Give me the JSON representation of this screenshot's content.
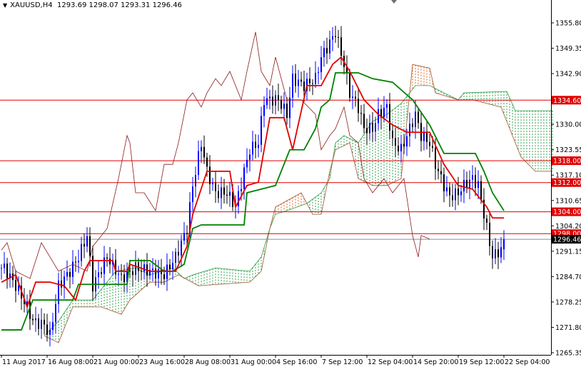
{
  "header": {
    "symbol": "XAUUSD,H4",
    "ohlc": "1293.69 1298.07 1293.31 1296.46"
  },
  "chart_data": {
    "type": "candlestick",
    "title": "XAUUSD,H4",
    "ylim": [
      1265.35,
      1355.8
    ],
    "y_ticks": [
      "1355.80",
      "1349.35",
      "1342.90",
      "1336.45",
      "1330.00",
      "1323.55",
      "1317.10",
      "1310.65",
      "1304.20",
      "1291.15",
      "1284.70",
      "1278.25",
      "1271.80",
      "1265.35"
    ],
    "x_ticks": [
      {
        "bar": 0,
        "label": "11 Aug 2017"
      },
      {
        "bar": 16,
        "label": "16 Aug 08:00"
      },
      {
        "bar": 32,
        "label": "21 Aug 00:00"
      },
      {
        "bar": 48,
        "label": "23 Aug 16:00"
      },
      {
        "bar": 64,
        "label": "28 Aug 08:00"
      },
      {
        "bar": 80,
        "label": "31 Aug 00:00"
      },
      {
        "bar": 96,
        "label": "4 Sep 16:00"
      },
      {
        "bar": 112,
        "label": "7 Sep 12:00"
      },
      {
        "bar": 128,
        "label": "12 Sep 04:00"
      },
      {
        "bar": 144,
        "label": "14 Sep 20:00"
      },
      {
        "bar": 160,
        "label": "19 Sep 12:00"
      },
      {
        "bar": 176,
        "label": "22 Sep 04:00"
      }
    ],
    "levels": [
      {
        "price": 1334.6,
        "label": "1334.60"
      },
      {
        "price": 1318.0,
        "label": "1318.00"
      },
      {
        "price": 1312.0,
        "label": "1312.00"
      },
      {
        "price": 1304.0,
        "label": "1304.00"
      },
      {
        "price": 1298.0,
        "label": "1298.00"
      }
    ],
    "current_price": {
      "price": 1296.46,
      "label": "1296.46"
    },
    "colors": {
      "level": "#e00000",
      "tenkan": "#e00000",
      "kijun": "#008000",
      "chikou": "#8b1a1a",
      "bull": "#0000ff",
      "bear": "#000000",
      "cloud_up": "#2e9e4a",
      "cloud_down": "#e06020"
    },
    "close_path": [
      [
        1,
        1288.6
      ],
      [
        5,
        1283.7
      ],
      [
        9,
        1277.9
      ],
      [
        11,
        1274.0
      ],
      [
        15,
        1273.0
      ],
      [
        17,
        1270.0
      ],
      [
        20,
        1283.7
      ],
      [
        24,
        1287.7
      ],
      [
        27,
        1291.6
      ],
      [
        30,
        1297.5
      ],
      [
        32,
        1283.7
      ],
      [
        37,
        1291.6
      ],
      [
        42,
        1285.7
      ],
      [
        47,
        1288.6
      ],
      [
        52,
        1287.7
      ],
      [
        57,
        1286.7
      ],
      [
        61,
        1291.6
      ],
      [
        65,
        1299.4
      ],
      [
        67,
        1311.2
      ],
      [
        70,
        1322.9
      ],
      [
        72,
        1315.1
      ],
      [
        75,
        1309.2
      ],
      [
        79,
        1309.2
      ],
      [
        82,
        1305.3
      ],
      [
        85,
        1315.1
      ],
      [
        87,
        1321.0
      ],
      [
        90,
        1322.9
      ],
      [
        92,
        1334.7
      ],
      [
        97,
        1334.7
      ],
      [
        100,
        1330.7
      ],
      [
        102,
        1340.5
      ],
      [
        106,
        1338.6
      ],
      [
        110,
        1340.5
      ],
      [
        112,
        1346.4
      ],
      [
        115,
        1350.3
      ],
      [
        117,
        1353.3
      ],
      [
        120,
        1344.4
      ],
      [
        122,
        1336.6
      ],
      [
        125,
        1332.7
      ],
      [
        127,
        1326.8
      ],
      [
        130,
        1326.8
      ],
      [
        132,
        1330.7
      ],
      [
        135,
        1332.7
      ],
      [
        137,
        1322.9
      ],
      [
        140,
        1321.0
      ],
      [
        142,
        1324.9
      ],
      [
        145,
        1330.7
      ],
      [
        147,
        1324.9
      ],
      [
        150,
        1322.9
      ],
      [
        152,
        1317.0
      ],
      [
        155,
        1311.2
      ],
      [
        157,
        1308.2
      ],
      [
        160,
        1309.2
      ],
      [
        162,
        1311.2
      ],
      [
        165,
        1313.1
      ],
      [
        167,
        1311.2
      ],
      [
        170,
        1299.4
      ],
      [
        172,
        1291.6
      ],
      [
        175,
        1293.69
      ],
      [
        176.5,
        1296.46
      ]
    ],
    "tenkan": [
      [
        0,
        1284.7
      ],
      [
        5,
        1286.7
      ],
      [
        9,
        1277.9
      ],
      [
        12,
        1284.7
      ],
      [
        17,
        1284.7
      ],
      [
        22,
        1283.7
      ],
      [
        26,
        1279.8
      ],
      [
        29,
        1287.7
      ],
      [
        31,
        1290.6
      ],
      [
        39,
        1290.6
      ],
      [
        40,
        1287.7
      ],
      [
        44,
        1287.7
      ],
      [
        45,
        1289.6
      ],
      [
        52,
        1287.7
      ],
      [
        57,
        1287.7
      ],
      [
        61,
        1287.7
      ],
      [
        65,
        1294.5
      ],
      [
        67,
        1303.3
      ],
      [
        72,
        1315.1
      ],
      [
        80,
        1315.1
      ],
      [
        82,
        1305.3
      ],
      [
        86,
        1311.2
      ],
      [
        90,
        1312.1
      ],
      [
        94,
        1329.8
      ],
      [
        99,
        1329.8
      ],
      [
        102,
        1321.0
      ],
      [
        107,
        1338.6
      ],
      [
        112,
        1338.6
      ],
      [
        116,
        1344.4
      ],
      [
        119,
        1346.4
      ],
      [
        122,
        1342.5
      ],
      [
        127,
        1334.7
      ],
      [
        132,
        1330.7
      ],
      [
        137,
        1327.8
      ],
      [
        142,
        1325.8
      ],
      [
        150,
        1325.8
      ],
      [
        155,
        1317.0
      ],
      [
        160,
        1311.2
      ],
      [
        165,
        1310.2
      ],
      [
        170,
        1305.3
      ],
      [
        172,
        1302.3
      ],
      [
        176,
        1302.3
      ]
    ],
    "kijun": [
      [
        0,
        1271.6
      ],
      [
        7,
        1271.6
      ],
      [
        11,
        1279.8
      ],
      [
        25,
        1279.8
      ],
      [
        27,
        1284.1
      ],
      [
        44,
        1284.1
      ],
      [
        45,
        1290.6
      ],
      [
        52,
        1290.6
      ],
      [
        57,
        1287.7
      ],
      [
        60,
        1287.7
      ],
      [
        64,
        1289.6
      ],
      [
        67,
        1299.4
      ],
      [
        70,
        1300.4
      ],
      [
        85,
        1300.4
      ],
      [
        86,
        1309.2
      ],
      [
        96,
        1311.2
      ],
      [
        101,
        1321.0
      ],
      [
        106,
        1321.0
      ],
      [
        110,
        1326.8
      ],
      [
        112,
        1332.7
      ],
      [
        115,
        1334.7
      ],
      [
        117,
        1342.1
      ],
      [
        125,
        1342.1
      ],
      [
        130,
        1340.5
      ],
      [
        137,
        1339.5
      ],
      [
        144,
        1334.7
      ],
      [
        150,
        1327.8
      ],
      [
        155,
        1320.0
      ],
      [
        166,
        1320.0
      ],
      [
        169,
        1315.1
      ],
      [
        172,
        1309.2
      ],
      [
        176,
        1304.3
      ]
    ],
    "senkou_a": [
      [
        15,
        1270.0
      ],
      [
        20,
        1274.0
      ],
      [
        25,
        1279.8
      ],
      [
        32,
        1279.8
      ],
      [
        40,
        1287.7
      ],
      [
        47,
        1288.6
      ],
      [
        52,
        1286.7
      ],
      [
        60,
        1288.6
      ],
      [
        64,
        1285.7
      ],
      [
        67,
        1286.7
      ],
      [
        75,
        1288.6
      ],
      [
        87,
        1287.7
      ],
      [
        91,
        1291.6
      ],
      [
        94,
        1299.4
      ],
      [
        96,
        1303.3
      ],
      [
        100,
        1304.3
      ],
      [
        107,
        1306.3
      ],
      [
        112,
        1309.2
      ],
      [
        115,
        1313.1
      ],
      [
        117,
        1322.9
      ],
      [
        120,
        1324.9
      ],
      [
        125,
        1322.9
      ],
      [
        130,
        1328.8
      ],
      [
        135,
        1330.7
      ],
      [
        140,
        1333.7
      ],
      [
        145,
        1338.6
      ],
      [
        150,
        1338.6
      ],
      [
        155,
        1336.6
      ],
      [
        160,
        1334.7
      ],
      [
        162,
        1336.6
      ],
      [
        177,
        1337.0
      ],
      [
        180,
        1331.7
      ],
      [
        193,
        1331.7
      ]
    ],
    "senkou_b": [
      [
        15,
        1270.0
      ],
      [
        20,
        1268.1
      ],
      [
        25,
        1277.9
      ],
      [
        35,
        1277.9
      ],
      [
        42,
        1275.9
      ],
      [
        45,
        1279.8
      ],
      [
        52,
        1284.7
      ],
      [
        57,
        1284.7
      ],
      [
        62,
        1286.7
      ],
      [
        69,
        1283.7
      ],
      [
        87,
        1284.7
      ],
      [
        91,
        1287.7
      ],
      [
        94,
        1299.4
      ],
      [
        96,
        1305.3
      ],
      [
        105,
        1309.2
      ],
      [
        109,
        1303.3
      ],
      [
        112,
        1303.3
      ],
      [
        115,
        1315.1
      ],
      [
        117,
        1321.0
      ],
      [
        122,
        1322.9
      ],
      [
        125,
        1313.1
      ],
      [
        130,
        1311.2
      ],
      [
        135,
        1311.2
      ],
      [
        140,
        1313.1
      ],
      [
        144,
        1344.4
      ],
      [
        150,
        1343.4
      ],
      [
        152,
        1336.6
      ],
      [
        160,
        1334.7
      ],
      [
        165,
        1334.7
      ],
      [
        175,
        1332.7
      ],
      [
        182,
        1319.0
      ],
      [
        187,
        1315.1
      ],
      [
        193,
        1315.1
      ]
    ],
    "chikou": [
      [
        0,
        1293.5
      ],
      [
        2,
        1295.5
      ],
      [
        5,
        1287.7
      ],
      [
        10,
        1285.7
      ],
      [
        14,
        1295.5
      ],
      [
        17,
        1291.6
      ],
      [
        20,
        1287.7
      ],
      [
        25,
        1289.6
      ],
      [
        30,
        1287.7
      ],
      [
        32,
        1294.5
      ],
      [
        37,
        1299.4
      ],
      [
        41,
        1313.1
      ],
      [
        44,
        1324.9
      ],
      [
        45,
        1322.9
      ],
      [
        47,
        1309.2
      ],
      [
        50,
        1309.2
      ],
      [
        54,
        1304.3
      ],
      [
        57,
        1317.0
      ],
      [
        60,
        1317.0
      ],
      [
        62,
        1322.9
      ],
      [
        65,
        1334.7
      ],
      [
        67,
        1336.6
      ],
      [
        70,
        1332.7
      ],
      [
        72,
        1336.6
      ],
      [
        75,
        1340.5
      ],
      [
        77,
        1338.6
      ],
      [
        80,
        1342.5
      ],
      [
        84,
        1334.7
      ],
      [
        86,
        1342.5
      ],
      [
        89,
        1353.3
      ],
      [
        91,
        1342.5
      ],
      [
        94,
        1338.6
      ],
      [
        96,
        1346.4
      ],
      [
        100,
        1334.7
      ],
      [
        105,
        1334.7
      ],
      [
        110,
        1330.7
      ],
      [
        112,
        1321.0
      ],
      [
        115,
        1324.9
      ],
      [
        117,
        1326.8
      ],
      [
        120,
        1332.7
      ],
      [
        122,
        1324.9
      ],
      [
        125,
        1322.9
      ],
      [
        127,
        1313.1
      ],
      [
        130,
        1309.2
      ],
      [
        134,
        1313.1
      ],
      [
        137,
        1309.2
      ],
      [
        141,
        1313.1
      ],
      [
        144,
        1297.5
      ],
      [
        146,
        1291.6
      ],
      [
        147,
        1297.5
      ],
      [
        150,
        1296.5
      ]
    ]
  }
}
